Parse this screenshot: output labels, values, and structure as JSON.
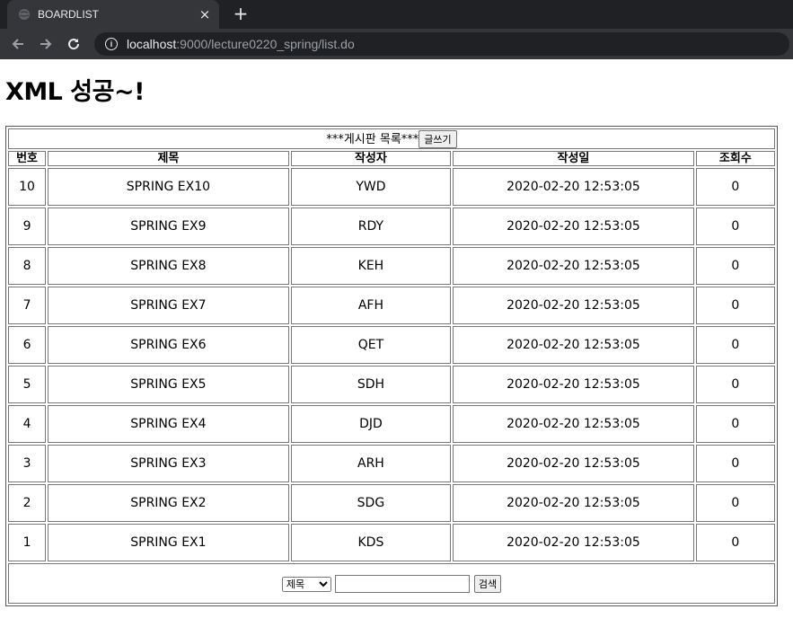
{
  "browser": {
    "tab_title": "BOARDLIST",
    "close_icon": "×",
    "new_tab_icon": "+",
    "url_host": "localhost",
    "url_rest": ":9000/lecture0220_spring/list.do"
  },
  "page": {
    "heading": "XML 성공~!"
  },
  "board": {
    "caption": "***게시판 목록***",
    "write_button": "글쓰기",
    "columns": [
      "번호",
      "제목",
      "작성자",
      "작성일",
      "조회수"
    ],
    "rows": [
      {
        "no": "10",
        "title": "SPRING EX10",
        "writer": "YWD",
        "date": "2020-02-20 12:53:05",
        "views": "0"
      },
      {
        "no": "9",
        "title": "SPRING EX9",
        "writer": "RDY",
        "date": "2020-02-20 12:53:05",
        "views": "0"
      },
      {
        "no": "8",
        "title": "SPRING EX8",
        "writer": "KEH",
        "date": "2020-02-20 12:53:05",
        "views": "0"
      },
      {
        "no": "7",
        "title": "SPRING EX7",
        "writer": "AFH",
        "date": "2020-02-20 12:53:05",
        "views": "0"
      },
      {
        "no": "6",
        "title": "SPRING EX6",
        "writer": "QET",
        "date": "2020-02-20 12:53:05",
        "views": "0"
      },
      {
        "no": "5",
        "title": "SPRING EX5",
        "writer": "SDH",
        "date": "2020-02-20 12:53:05",
        "views": "0"
      },
      {
        "no": "4",
        "title": "SPRING EX4",
        "writer": "DJD",
        "date": "2020-02-20 12:53:05",
        "views": "0"
      },
      {
        "no": "3",
        "title": "SPRING EX3",
        "writer": "ARH",
        "date": "2020-02-20 12:53:05",
        "views": "0"
      },
      {
        "no": "2",
        "title": "SPRING EX2",
        "writer": "SDG",
        "date": "2020-02-20 12:53:05",
        "views": "0"
      },
      {
        "no": "1",
        "title": "SPRING EX1",
        "writer": "KDS",
        "date": "2020-02-20 12:53:05",
        "views": "0"
      }
    ]
  },
  "search": {
    "selected_option": "제목",
    "input_value": "",
    "button_label": "검색"
  },
  "colors": {
    "tabbar_bg": "#202124",
    "toolbar_bg": "#35363a"
  }
}
